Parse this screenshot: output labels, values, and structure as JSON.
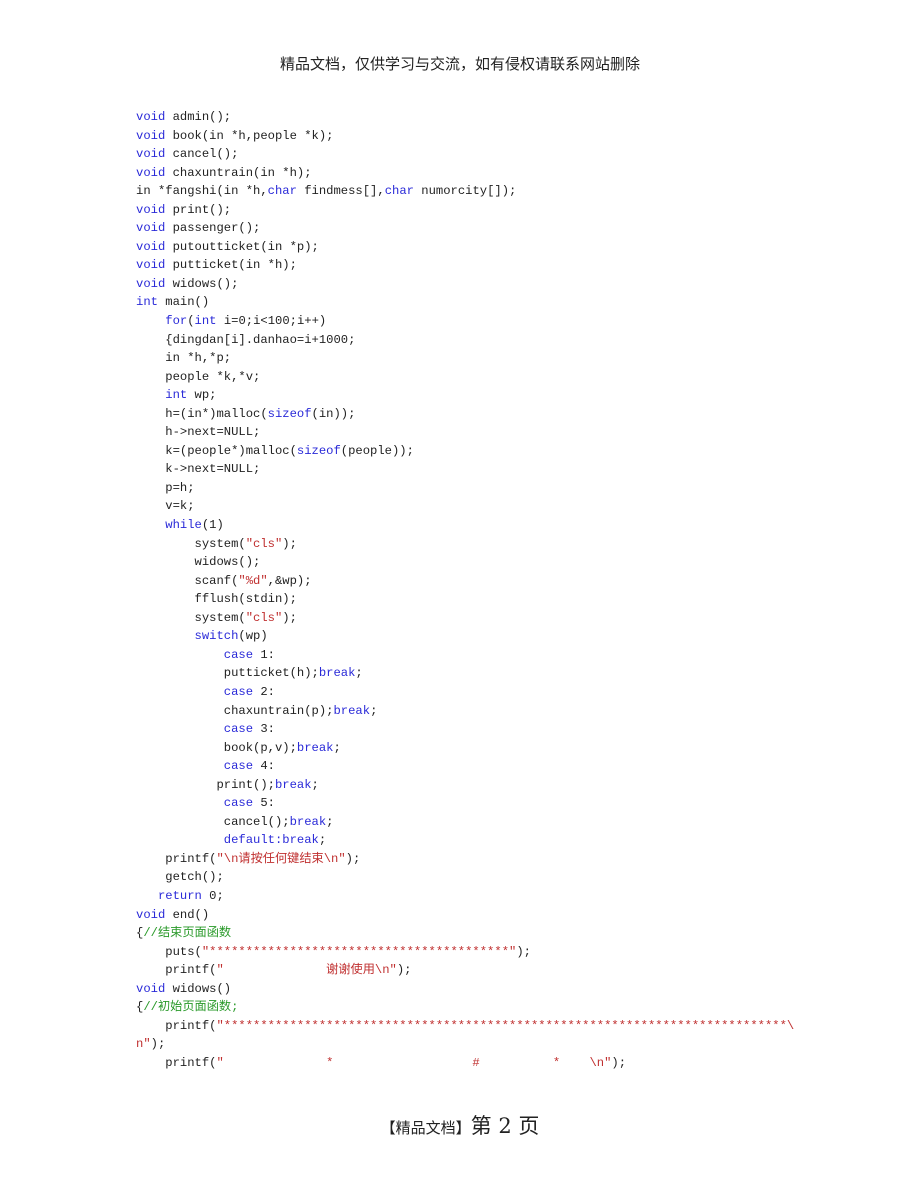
{
  "header": {
    "text": "精品文档，仅供学习与交流，如有侵权请联系网站删除"
  },
  "footer": {
    "tag": "【精品文档】",
    "page_label": "第 2 页"
  },
  "colors": {
    "keyword": "#2a2ad8",
    "string": "#c03030",
    "comment": "#2a9a2a",
    "text": "#222222"
  },
  "code": [
    [
      {
        "t": "kw",
        "v": "void"
      },
      {
        "t": "p",
        "v": " admin();"
      }
    ],
    [
      {
        "t": "kw",
        "v": "void"
      },
      {
        "t": "p",
        "v": " book(in *h,people *k);"
      }
    ],
    [
      {
        "t": "kw",
        "v": "void"
      },
      {
        "t": "p",
        "v": " cancel();"
      }
    ],
    [
      {
        "t": "kw",
        "v": "void"
      },
      {
        "t": "p",
        "v": " chaxuntrain(in *h);"
      }
    ],
    [
      {
        "t": "p",
        "v": "in *fangshi(in *h,"
      },
      {
        "t": "kw",
        "v": "char"
      },
      {
        "t": "p",
        "v": " findmess[],"
      },
      {
        "t": "kw",
        "v": "char"
      },
      {
        "t": "p",
        "v": " numorcity[]);"
      }
    ],
    [
      {
        "t": "kw",
        "v": "void"
      },
      {
        "t": "p",
        "v": " print();"
      }
    ],
    [
      {
        "t": "kw",
        "v": "void"
      },
      {
        "t": "p",
        "v": " passenger();"
      }
    ],
    [
      {
        "t": "kw",
        "v": "void"
      },
      {
        "t": "p",
        "v": " putoutticket(in *p);"
      }
    ],
    [
      {
        "t": "kw",
        "v": "void"
      },
      {
        "t": "p",
        "v": " putticket(in *h);"
      }
    ],
    [
      {
        "t": "kw",
        "v": "void"
      },
      {
        "t": "p",
        "v": " widows();"
      }
    ],
    [
      {
        "t": "kw",
        "v": "int"
      },
      {
        "t": "p",
        "v": " main()"
      }
    ],
    [
      {
        "t": "p",
        "v": "    "
      },
      {
        "t": "kw",
        "v": "for"
      },
      {
        "t": "p",
        "v": "("
      },
      {
        "t": "kw",
        "v": "int"
      },
      {
        "t": "p",
        "v": " i=0;i<100;i++)"
      }
    ],
    [
      {
        "t": "p",
        "v": "    {dingdan[i].danhao=i+1000;"
      }
    ],
    [
      {
        "t": "p",
        "v": "    in *h,*p;"
      }
    ],
    [
      {
        "t": "p",
        "v": "    people *k,*v;"
      }
    ],
    [
      {
        "t": "p",
        "v": "    "
      },
      {
        "t": "kw",
        "v": "int"
      },
      {
        "t": "p",
        "v": " wp;"
      }
    ],
    [
      {
        "t": "p",
        "v": "    h=(in*)malloc("
      },
      {
        "t": "kw",
        "v": "sizeof"
      },
      {
        "t": "p",
        "v": "(in));"
      }
    ],
    [
      {
        "t": "p",
        "v": "    h->next=NULL;"
      }
    ],
    [
      {
        "t": "p",
        "v": "    k=(people*)malloc("
      },
      {
        "t": "kw",
        "v": "sizeof"
      },
      {
        "t": "p",
        "v": "(people));"
      }
    ],
    [
      {
        "t": "p",
        "v": "    k->next=NULL;"
      }
    ],
    [
      {
        "t": "p",
        "v": "    p=h;"
      }
    ],
    [
      {
        "t": "p",
        "v": "    v=k;"
      }
    ],
    [
      {
        "t": "p",
        "v": "    "
      },
      {
        "t": "kw",
        "v": "while"
      },
      {
        "t": "p",
        "v": "(1)"
      }
    ],
    [
      {
        "t": "p",
        "v": "        system("
      },
      {
        "t": "str",
        "v": "\"cls\""
      },
      {
        "t": "p",
        "v": ");"
      }
    ],
    [
      {
        "t": "p",
        "v": "        widows();"
      }
    ],
    [
      {
        "t": "p",
        "v": "        scanf("
      },
      {
        "t": "str",
        "v": "\"%d\""
      },
      {
        "t": "p",
        "v": ",&wp);"
      }
    ],
    [
      {
        "t": "p",
        "v": "        fflush(stdin);"
      }
    ],
    [
      {
        "t": "p",
        "v": "        system("
      },
      {
        "t": "str",
        "v": "\"cls\""
      },
      {
        "t": "p",
        "v": ");"
      }
    ],
    [
      {
        "t": "p",
        "v": "        "
      },
      {
        "t": "kw",
        "v": "switch"
      },
      {
        "t": "p",
        "v": "(wp)"
      }
    ],
    [
      {
        "t": "p",
        "v": "            "
      },
      {
        "t": "kw",
        "v": "case"
      },
      {
        "t": "p",
        "v": " 1:"
      }
    ],
    [
      {
        "t": "p",
        "v": "            putticket(h);"
      },
      {
        "t": "kw",
        "v": "break"
      },
      {
        "t": "p",
        "v": ";"
      }
    ],
    [
      {
        "t": "p",
        "v": "            "
      },
      {
        "t": "kw",
        "v": "case"
      },
      {
        "t": "p",
        "v": " 2:"
      }
    ],
    [
      {
        "t": "p",
        "v": "            chaxuntrain(p);"
      },
      {
        "t": "kw",
        "v": "break"
      },
      {
        "t": "p",
        "v": ";"
      }
    ],
    [
      {
        "t": "p",
        "v": "            "
      },
      {
        "t": "kw",
        "v": "case"
      },
      {
        "t": "p",
        "v": " 3:"
      }
    ],
    [
      {
        "t": "p",
        "v": "            book(p,v);"
      },
      {
        "t": "kw",
        "v": "break"
      },
      {
        "t": "p",
        "v": ";"
      }
    ],
    [
      {
        "t": "p",
        "v": "            "
      },
      {
        "t": "kw",
        "v": "case"
      },
      {
        "t": "p",
        "v": " 4:"
      }
    ],
    [
      {
        "t": "p",
        "v": "           print();"
      },
      {
        "t": "kw",
        "v": "break"
      },
      {
        "t": "p",
        "v": ";"
      }
    ],
    [
      {
        "t": "p",
        "v": "            "
      },
      {
        "t": "kw",
        "v": "case"
      },
      {
        "t": "p",
        "v": " 5:"
      }
    ],
    [
      {
        "t": "p",
        "v": "            cancel();"
      },
      {
        "t": "kw",
        "v": "break"
      },
      {
        "t": "p",
        "v": ";"
      }
    ],
    [
      {
        "t": "p",
        "v": "            "
      },
      {
        "t": "kw",
        "v": "default:break"
      },
      {
        "t": "p",
        "v": ";"
      }
    ],
    [
      {
        "t": "p",
        "v": "    printf("
      },
      {
        "t": "str",
        "v": "\"\\n请按任何键结束\\n\""
      },
      {
        "t": "p",
        "v": ");"
      }
    ],
    [
      {
        "t": "p",
        "v": "    getch();"
      }
    ],
    [
      {
        "t": "p",
        "v": "  "
      },
      {
        "t": "kw",
        "v": " return"
      },
      {
        "t": "p",
        "v": " 0;"
      }
    ],
    [
      {
        "t": "kw",
        "v": "void"
      },
      {
        "t": "p",
        "v": " end()"
      }
    ],
    [
      {
        "t": "p",
        "v": "{"
      },
      {
        "t": "cm",
        "v": "//结束页面函数"
      }
    ],
    [
      {
        "t": "p",
        "v": "    puts("
      },
      {
        "t": "str",
        "v": "\"*****************************************\""
      },
      {
        "t": "p",
        "v": ");"
      }
    ],
    [
      {
        "t": "p",
        "v": "    printf("
      },
      {
        "t": "str",
        "v": "\"              谢谢使用\\n\""
      },
      {
        "t": "p",
        "v": ");"
      }
    ],
    [
      {
        "t": "kw",
        "v": "void"
      },
      {
        "t": "p",
        "v": " widows()"
      }
    ],
    [
      {
        "t": "p",
        "v": "{"
      },
      {
        "t": "cm",
        "v": "//初始页面函数;"
      }
    ],
    [
      {
        "t": "p",
        "v": "    printf("
      },
      {
        "t": "str",
        "v": "\"*****************************************************************************\\"
      }
    ],
    [
      {
        "t": "str",
        "v": "n\""
      },
      {
        "t": "p",
        "v": ");"
      }
    ],
    [
      {
        "t": "p",
        "v": "    printf("
      },
      {
        "t": "str",
        "v": "\"              *                   #          *    \\n\""
      },
      {
        "t": "p",
        "v": ");"
      }
    ]
  ]
}
